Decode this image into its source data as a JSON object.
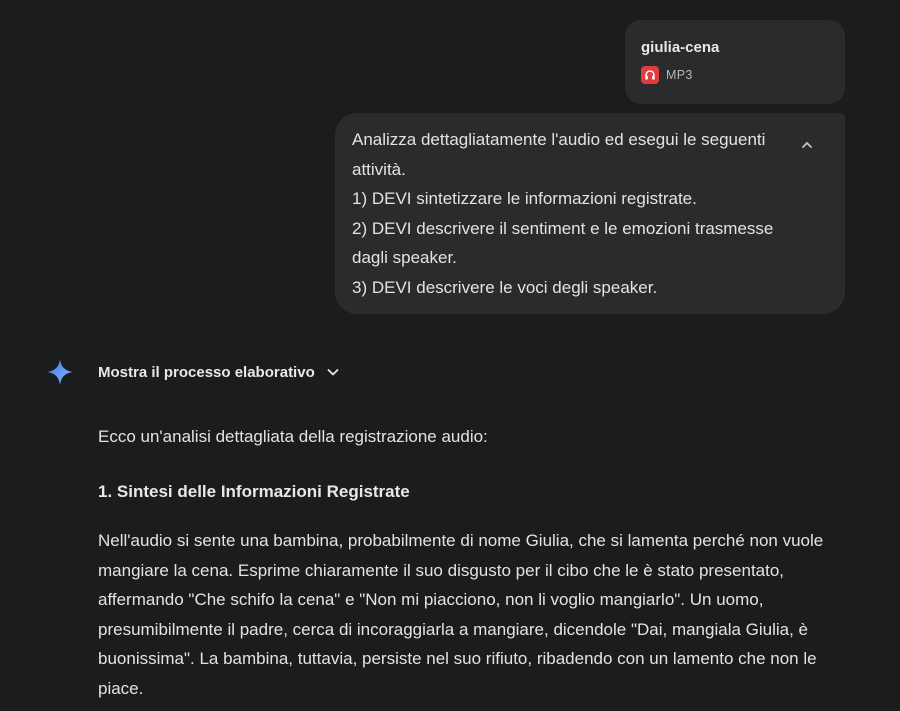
{
  "attachment": {
    "name": "giulia-cena",
    "type": "MP3",
    "icon": "headphones-icon"
  },
  "prompt": {
    "lines": [
      "Analizza dettagliatamente l'audio ed esegui le seguenti",
      "attività.",
      "1) DEVI sintetizzare le informazioni registrate.",
      "2) DEVI descrivere il sentiment e le emozioni trasmesse",
      "dagli speaker.",
      "3) DEVI descrivere le voci degli speaker."
    ],
    "collapse_icon": "chevron-up-icon"
  },
  "assistant": {
    "icon": "gemini-sparkle-icon",
    "thinking_label": "Mostra il processo elaborativo",
    "thinking_icon": "chevron-down-icon"
  },
  "response": {
    "intro": "Ecco un'analisi dettagliata della registrazione audio:",
    "heading": "1. Sintesi delle Informazioni Registrate",
    "paragraph_lines": [
      "Nell'audio si sente una bambina, probabilmente di nome Giulia, che si lamenta perché non vuole",
      "mangiare la cena. Esprime chiaramente il suo disgusto per il cibo che le è stato presentato,",
      "affermando \"Che schifo la cena\" e \"Non mi piacciono, non li voglio mangiarlo\". Un uomo,",
      "presumibilmente il padre, cerca di incoraggiarla a mangiare, dicendole \"Dai, mangiala Giulia, è",
      "buonissima\". La bambina, tuttavia, persiste nel suo rifiuto, ribadendo con un lamento che non le",
      "piace."
    ]
  },
  "colors": {
    "background": "#1b1c1d",
    "bubble": "#2a2b2d",
    "mp3_badge": "#e23b3b",
    "gemini_blue": "#4a8af4"
  }
}
